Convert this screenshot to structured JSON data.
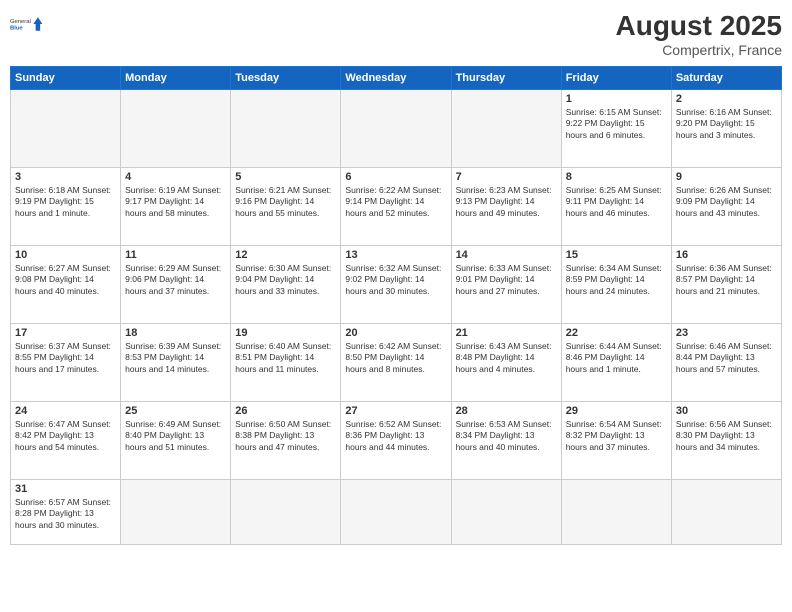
{
  "header": {
    "logo_general": "General",
    "logo_blue": "Blue",
    "month_title": "August 2025",
    "location": "Compertrix, France"
  },
  "weekdays": [
    "Sunday",
    "Monday",
    "Tuesday",
    "Wednesday",
    "Thursday",
    "Friday",
    "Saturday"
  ],
  "weeks": [
    [
      {
        "day": "",
        "info": ""
      },
      {
        "day": "",
        "info": ""
      },
      {
        "day": "",
        "info": ""
      },
      {
        "day": "",
        "info": ""
      },
      {
        "day": "",
        "info": ""
      },
      {
        "day": "1",
        "info": "Sunrise: 6:15 AM\nSunset: 9:22 PM\nDaylight: 15 hours\nand 6 minutes."
      },
      {
        "day": "2",
        "info": "Sunrise: 6:16 AM\nSunset: 9:20 PM\nDaylight: 15 hours\nand 3 minutes."
      }
    ],
    [
      {
        "day": "3",
        "info": "Sunrise: 6:18 AM\nSunset: 9:19 PM\nDaylight: 15 hours\nand 1 minute."
      },
      {
        "day": "4",
        "info": "Sunrise: 6:19 AM\nSunset: 9:17 PM\nDaylight: 14 hours\nand 58 minutes."
      },
      {
        "day": "5",
        "info": "Sunrise: 6:21 AM\nSunset: 9:16 PM\nDaylight: 14 hours\nand 55 minutes."
      },
      {
        "day": "6",
        "info": "Sunrise: 6:22 AM\nSunset: 9:14 PM\nDaylight: 14 hours\nand 52 minutes."
      },
      {
        "day": "7",
        "info": "Sunrise: 6:23 AM\nSunset: 9:13 PM\nDaylight: 14 hours\nand 49 minutes."
      },
      {
        "day": "8",
        "info": "Sunrise: 6:25 AM\nSunset: 9:11 PM\nDaylight: 14 hours\nand 46 minutes."
      },
      {
        "day": "9",
        "info": "Sunrise: 6:26 AM\nSunset: 9:09 PM\nDaylight: 14 hours\nand 43 minutes."
      }
    ],
    [
      {
        "day": "10",
        "info": "Sunrise: 6:27 AM\nSunset: 9:08 PM\nDaylight: 14 hours\nand 40 minutes."
      },
      {
        "day": "11",
        "info": "Sunrise: 6:29 AM\nSunset: 9:06 PM\nDaylight: 14 hours\nand 37 minutes."
      },
      {
        "day": "12",
        "info": "Sunrise: 6:30 AM\nSunset: 9:04 PM\nDaylight: 14 hours\nand 33 minutes."
      },
      {
        "day": "13",
        "info": "Sunrise: 6:32 AM\nSunset: 9:02 PM\nDaylight: 14 hours\nand 30 minutes."
      },
      {
        "day": "14",
        "info": "Sunrise: 6:33 AM\nSunset: 9:01 PM\nDaylight: 14 hours\nand 27 minutes."
      },
      {
        "day": "15",
        "info": "Sunrise: 6:34 AM\nSunset: 8:59 PM\nDaylight: 14 hours\nand 24 minutes."
      },
      {
        "day": "16",
        "info": "Sunrise: 6:36 AM\nSunset: 8:57 PM\nDaylight: 14 hours\nand 21 minutes."
      }
    ],
    [
      {
        "day": "17",
        "info": "Sunrise: 6:37 AM\nSunset: 8:55 PM\nDaylight: 14 hours\nand 17 minutes."
      },
      {
        "day": "18",
        "info": "Sunrise: 6:39 AM\nSunset: 8:53 PM\nDaylight: 14 hours\nand 14 minutes."
      },
      {
        "day": "19",
        "info": "Sunrise: 6:40 AM\nSunset: 8:51 PM\nDaylight: 14 hours\nand 11 minutes."
      },
      {
        "day": "20",
        "info": "Sunrise: 6:42 AM\nSunset: 8:50 PM\nDaylight: 14 hours\nand 8 minutes."
      },
      {
        "day": "21",
        "info": "Sunrise: 6:43 AM\nSunset: 8:48 PM\nDaylight: 14 hours\nand 4 minutes."
      },
      {
        "day": "22",
        "info": "Sunrise: 6:44 AM\nSunset: 8:46 PM\nDaylight: 14 hours\nand 1 minute."
      },
      {
        "day": "23",
        "info": "Sunrise: 6:46 AM\nSunset: 8:44 PM\nDaylight: 13 hours\nand 57 minutes."
      }
    ],
    [
      {
        "day": "24",
        "info": "Sunrise: 6:47 AM\nSunset: 8:42 PM\nDaylight: 13 hours\nand 54 minutes."
      },
      {
        "day": "25",
        "info": "Sunrise: 6:49 AM\nSunset: 8:40 PM\nDaylight: 13 hours\nand 51 minutes."
      },
      {
        "day": "26",
        "info": "Sunrise: 6:50 AM\nSunset: 8:38 PM\nDaylight: 13 hours\nand 47 minutes."
      },
      {
        "day": "27",
        "info": "Sunrise: 6:52 AM\nSunset: 8:36 PM\nDaylight: 13 hours\nand 44 minutes."
      },
      {
        "day": "28",
        "info": "Sunrise: 6:53 AM\nSunset: 8:34 PM\nDaylight: 13 hours\nand 40 minutes."
      },
      {
        "day": "29",
        "info": "Sunrise: 6:54 AM\nSunset: 8:32 PM\nDaylight: 13 hours\nand 37 minutes."
      },
      {
        "day": "30",
        "info": "Sunrise: 6:56 AM\nSunset: 8:30 PM\nDaylight: 13 hours\nand 34 minutes."
      }
    ],
    [
      {
        "day": "31",
        "info": "Sunrise: 6:57 AM\nSunset: 8:28 PM\nDaylight: 13 hours\nand 30 minutes."
      },
      {
        "day": "",
        "info": ""
      },
      {
        "day": "",
        "info": ""
      },
      {
        "day": "",
        "info": ""
      },
      {
        "day": "",
        "info": ""
      },
      {
        "day": "",
        "info": ""
      },
      {
        "day": "",
        "info": ""
      }
    ]
  ]
}
